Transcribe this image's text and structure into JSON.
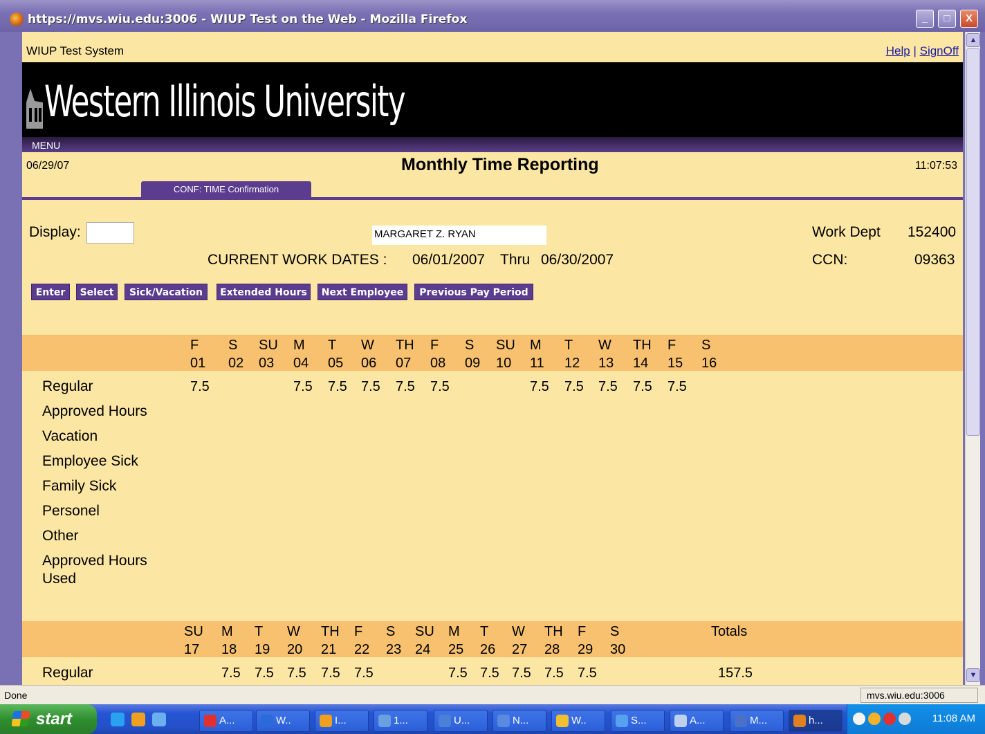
{
  "window": {
    "title": "https://mvs.wiu.edu:3006 - WIUP Test on the Web - Mozilla Firefox",
    "min_label": "_",
    "max_label": "□",
    "close_label": "X"
  },
  "header": {
    "system_name": "WIUP Test System",
    "help_link": "Help",
    "separator": "|",
    "signoff_link": "SignOff",
    "logo_text": "Western Illinois University",
    "menu_label": "MENU"
  },
  "datebar": {
    "date": "06/29/07",
    "title": "Monthly Time Reporting",
    "time": "11:07:53"
  },
  "tab": {
    "label": "CONF: TIME Confirmation"
  },
  "form": {
    "display_label": "Display:",
    "display_value": "",
    "employee_name": "MARGARET Z. RYAN",
    "work_dept_label": "Work Dept",
    "work_dept_value": "152400",
    "ccn_label": "CCN:",
    "ccn_value": "09363",
    "current_work_dates_label": "CURRENT WORK DATES :",
    "start_date": "06/01/2007",
    "thru_label": "Thru",
    "end_date": "06/30/2007"
  },
  "buttons": {
    "enter": "Enter",
    "select": "Select",
    "sick_vacation": "Sick/Vacation",
    "extended_hours": "Extended Hours",
    "next_employee": "Next Employee",
    "previous_pay_period": "Previous Pay Period"
  },
  "period1": {
    "days": [
      {
        "dow": "F",
        "d": "01"
      },
      {
        "dow": "S",
        "d": "02"
      },
      {
        "dow": "SU",
        "d": "03"
      },
      {
        "dow": "M",
        "d": "04"
      },
      {
        "dow": "T",
        "d": "05"
      },
      {
        "dow": "W",
        "d": "06"
      },
      {
        "dow": "TH",
        "d": "07"
      },
      {
        "dow": "F",
        "d": "08"
      },
      {
        "dow": "S",
        "d": "09"
      },
      {
        "dow": "SU",
        "d": "10"
      },
      {
        "dow": "M",
        "d": "11"
      },
      {
        "dow": "T",
        "d": "12"
      },
      {
        "dow": "W",
        "d": "13"
      },
      {
        "dow": "TH",
        "d": "14"
      },
      {
        "dow": "F",
        "d": "15"
      },
      {
        "dow": "S",
        "d": "16"
      }
    ],
    "rows": [
      {
        "label": "Regular",
        "values": [
          "7.5",
          "",
          "",
          "7.5",
          "7.5",
          "7.5",
          "7.5",
          "7.5",
          "",
          "",
          "7.5",
          "7.5",
          "7.5",
          "7.5",
          "7.5",
          ""
        ]
      },
      {
        "label": "Approved Hours",
        "values": []
      },
      {
        "label": "Vacation",
        "values": []
      },
      {
        "label": "Employee Sick",
        "values": []
      },
      {
        "label": "Family Sick",
        "values": []
      },
      {
        "label": "Personel",
        "values": []
      },
      {
        "label": "Other",
        "values": []
      },
      {
        "label": "Approved Hours Used",
        "values": []
      }
    ]
  },
  "period2": {
    "days": [
      {
        "dow": "SU",
        "d": "17"
      },
      {
        "dow": "M",
        "d": "18"
      },
      {
        "dow": "T",
        "d": "19"
      },
      {
        "dow": "W",
        "d": "20"
      },
      {
        "dow": "TH",
        "d": "21"
      },
      {
        "dow": "F",
        "d": "22"
      },
      {
        "dow": "S",
        "d": "23"
      },
      {
        "dow": "SU",
        "d": "24"
      },
      {
        "dow": "M",
        "d": "25"
      },
      {
        "dow": "T",
        "d": "26"
      },
      {
        "dow": "W",
        "d": "27"
      },
      {
        "dow": "TH",
        "d": "28"
      },
      {
        "dow": "F",
        "d": "29"
      },
      {
        "dow": "S",
        "d": "30"
      }
    ],
    "totals_label": "Totals",
    "rows": [
      {
        "label": "Regular",
        "values": [
          "",
          "7.5",
          "7.5",
          "7.5",
          "7.5",
          "7.5",
          "",
          "",
          "7.5",
          "7.5",
          "7.5",
          "7.5",
          "7.5",
          ""
        ],
        "total": "157.5"
      }
    ]
  },
  "statusbar": {
    "status": "Done",
    "host": "mvs.wiu.edu:3006"
  },
  "taskbar": {
    "start_label": "start",
    "items": [
      "A...",
      "W..",
      "I...",
      "1...",
      "U...",
      "N...",
      "W..",
      "S...",
      "A...",
      "M...",
      "h..."
    ],
    "clock": "11:08 AM"
  }
}
